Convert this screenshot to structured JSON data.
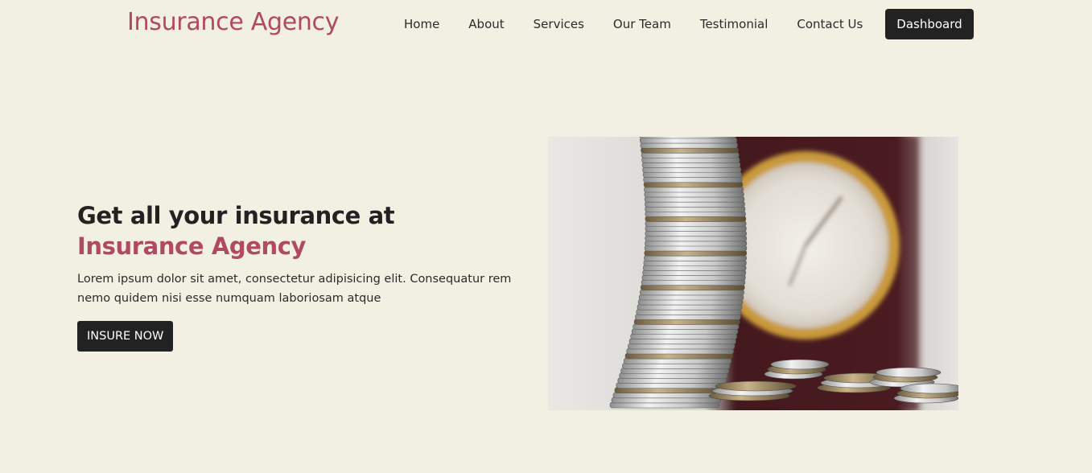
{
  "header": {
    "brand": "Insurance Agency",
    "nav": [
      {
        "label": "Home"
      },
      {
        "label": "About"
      },
      {
        "label": "Services"
      },
      {
        "label": "Our Team"
      },
      {
        "label": "Testimonial"
      },
      {
        "label": "Contact Us"
      }
    ],
    "dashboard_label": "Dashboard"
  },
  "hero": {
    "title_prefix": "Get all your insurance at ",
    "title_accent": "Insurance Agency",
    "description": "Lorem ipsum dolor sit amet, consectetur adipisicing elit. Consequatur rem nemo quidem nisi esse numquam laboriosam atque",
    "cta_label": "INSURE NOW",
    "image": "stacked-coins-and-clock-photo"
  },
  "colors": {
    "background": "#f1f0e3",
    "accent": "#b04a60",
    "button": "#222222"
  }
}
